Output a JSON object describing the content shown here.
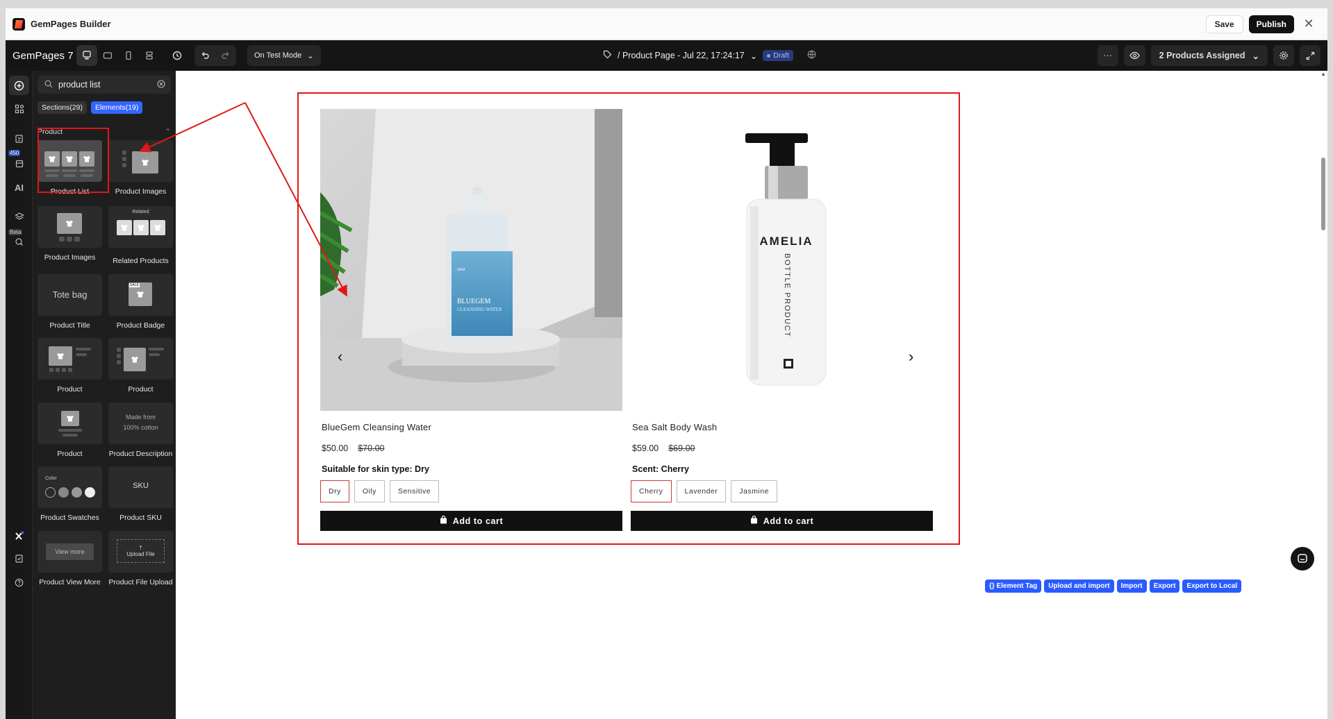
{
  "window": {
    "title": "GemPages Builder",
    "save": "Save",
    "publish": "Publish",
    "close": "✕"
  },
  "toolbar": {
    "brand": "GemPages 7",
    "mode": "On Test Mode",
    "page_title": "/ Product Page - Jul 22, 17:24:17",
    "status": "Draft",
    "more": "···",
    "assigned": "2 Products Assigned"
  },
  "rail": {
    "badge": "450",
    "ai": "AI",
    "beta": "Beta"
  },
  "panel": {
    "search_value": "product list",
    "tabs": [
      "Sections(29)",
      "Elements(19)"
    ],
    "category": "Product",
    "items": [
      "Product List",
      "Product Images",
      "Product Images",
      "Related Products",
      "Product Title",
      "Product Badge",
      "Product",
      "Product",
      "Product",
      "Product Description",
      "Product Swatches",
      "Product SKU",
      "Product View More",
      "Product File Upload"
    ],
    "thumbs": {
      "related": "Related",
      "tote": "Tote bag",
      "sale": "SALE",
      "desc1": "Made from",
      "desc2": "100% cotton",
      "color": "Color",
      "sku": "SKU",
      "view_more": "View more",
      "upload": "Upload File"
    }
  },
  "products": [
    {
      "name": "BlueGem Cleansing Water",
      "price": "$50.00",
      "compare_price": "$70.00",
      "option_title": "Suitable for skin type: Dry",
      "options": [
        "Dry",
        "Oily",
        "Sensitive"
      ],
      "selected": 0,
      "cta": "Add to cart",
      "label_brand": "GEM",
      "label_text": "BLUEGEM",
      "label_sub": "CLEANSING WATER"
    },
    {
      "name": "Sea Salt Body Wash",
      "price": "$59.00",
      "compare_price": "$69.00",
      "option_title": "Scent: Cherry",
      "options": [
        "Cherry",
        "Lavender",
        "Jasmine"
      ],
      "selected": 0,
      "cta": "Add to cart",
      "label_brand": "AMELIA",
      "label_sub": "BOTTLE PRODUCT"
    }
  ],
  "bottom_actions": [
    "{} Element Tag",
    "Upload and import",
    "Import",
    "Export",
    "Export to Local"
  ],
  "colors": {
    "accent": "#3366ff",
    "highlight": "#e01818",
    "dark": "#151515"
  }
}
